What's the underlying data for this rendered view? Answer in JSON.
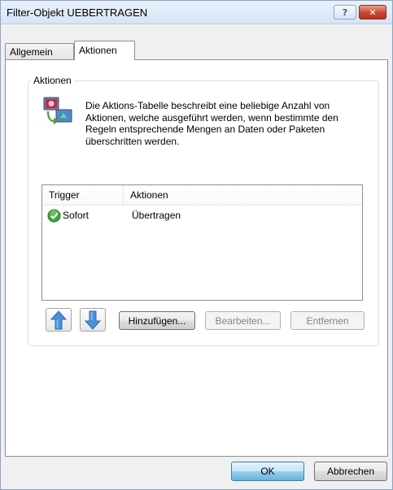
{
  "window": {
    "title": "Filter-Objekt UEBERTRAGEN",
    "help_label": "?",
    "close_label": "✕"
  },
  "tabs": [
    {
      "label": "Allgemein",
      "active": false
    },
    {
      "label": "Aktionen",
      "active": true
    }
  ],
  "group": {
    "legend": "Aktionen",
    "icon": "actions-table-icon",
    "description": "Die Aktions-Tabelle beschreibt eine beliebige Anzahl von Aktionen, welche ausgeführt werden, wenn bestimmte den Regeln entsprechende Mengen an Daten oder Paketen überschritten werden."
  },
  "table": {
    "columns": [
      "Trigger",
      "Aktionen"
    ],
    "rows": [
      {
        "trigger": "Sofort",
        "action": "Übertragen",
        "status_icon": "green-check-icon"
      }
    ]
  },
  "list_buttons": {
    "move_up_icon": "arrow-up-icon",
    "move_down_icon": "arrow-down-icon",
    "add_label": "Hinzufügen...",
    "edit_label": "Bearbeiten...",
    "remove_label": "Entfernen"
  },
  "footer": {
    "ok_label": "OK",
    "cancel_label": "Abbrechen"
  },
  "colors": {
    "accent": "#3c7fb1",
    "close_button": "#c44732",
    "arrow_blue": "#4a90d9",
    "check_green": "#3aa53a"
  }
}
